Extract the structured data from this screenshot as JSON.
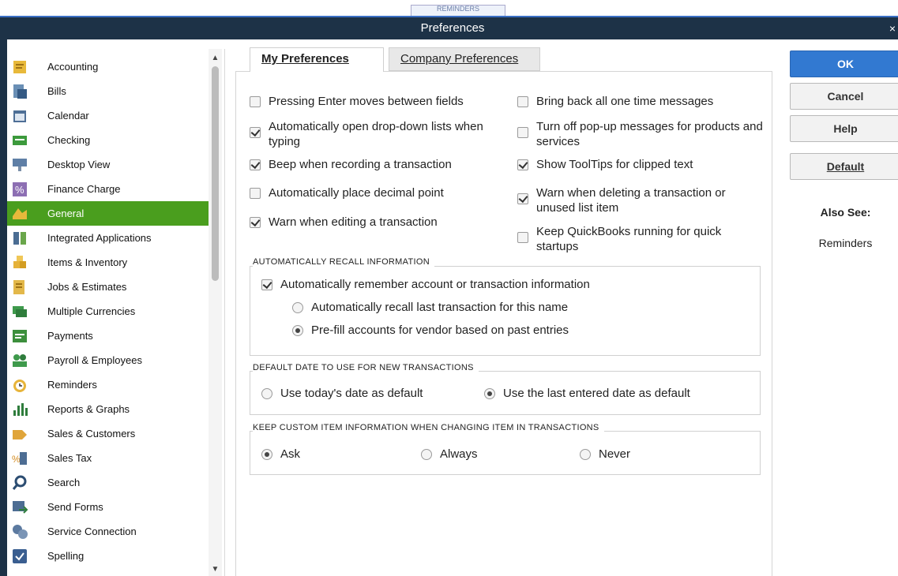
{
  "window": {
    "title": "Preferences",
    "close_glyph": "×",
    "background_tab": "REMINDERS"
  },
  "sidebar": {
    "items": [
      {
        "label": "Accounting",
        "icon": "accounting-icon"
      },
      {
        "label": "Bills",
        "icon": "bills-icon"
      },
      {
        "label": "Calendar",
        "icon": "calendar-icon"
      },
      {
        "label": "Checking",
        "icon": "checking-icon"
      },
      {
        "label": "Desktop View",
        "icon": "desktop-view-icon"
      },
      {
        "label": "Finance Charge",
        "icon": "finance-charge-icon"
      },
      {
        "label": "General",
        "icon": "general-icon",
        "active": true
      },
      {
        "label": "Integrated Applications",
        "icon": "integrated-applications-icon"
      },
      {
        "label": "Items & Inventory",
        "icon": "items-inventory-icon"
      },
      {
        "label": "Jobs & Estimates",
        "icon": "jobs-estimates-icon"
      },
      {
        "label": "Multiple Currencies",
        "icon": "multiple-currencies-icon"
      },
      {
        "label": "Payments",
        "icon": "payments-icon"
      },
      {
        "label": "Payroll & Employees",
        "icon": "payroll-employees-icon"
      },
      {
        "label": "Reminders",
        "icon": "reminders-icon"
      },
      {
        "label": "Reports & Graphs",
        "icon": "reports-graphs-icon"
      },
      {
        "label": "Sales & Customers",
        "icon": "sales-customers-icon"
      },
      {
        "label": "Sales Tax",
        "icon": "sales-tax-icon"
      },
      {
        "label": "Search",
        "icon": "search-icon"
      },
      {
        "label": "Send Forms",
        "icon": "send-forms-icon"
      },
      {
        "label": "Service Connection",
        "icon": "service-connection-icon"
      },
      {
        "label": "Spelling",
        "icon": "spelling-icon"
      }
    ]
  },
  "tabs": {
    "my": "My Preferences",
    "company": "Company Preferences"
  },
  "options": {
    "enter_moves": {
      "label": "Pressing Enter moves between fields",
      "checked": false
    },
    "auto_dropdown": {
      "label": "Automatically open drop-down lists when typing",
      "checked": true
    },
    "beep": {
      "label": "Beep when recording a transaction",
      "checked": true
    },
    "decimal": {
      "label": "Automatically place decimal point",
      "checked": false
    },
    "warn_edit": {
      "label": "Warn when editing a transaction",
      "checked": true
    },
    "bring_back": {
      "label": "Bring back all one time messages",
      "checked": false
    },
    "popups": {
      "label": "Turn off pop-up messages for products and services",
      "checked": false
    },
    "tooltips": {
      "label": "Show ToolTips for clipped text",
      "checked": true
    },
    "warn_delete": {
      "label": "Warn when deleting a transaction or unused list item",
      "checked": true
    },
    "keep_running": {
      "label": "Keep QuickBooks running for quick startups",
      "checked": false
    }
  },
  "recall": {
    "title": "AUTOMATICALLY RECALL INFORMATION",
    "remember": {
      "label": "Automatically remember account or transaction information",
      "checked": true
    },
    "last_txn": {
      "label": "Automatically recall last transaction for this name",
      "selected": false
    },
    "prefill": {
      "label": "Pre-fill accounts for vendor based on past entries",
      "selected": true
    }
  },
  "date_group": {
    "title": "DEFAULT DATE TO USE FOR NEW TRANSACTIONS",
    "today": {
      "label": "Use today's date as default",
      "selected": false
    },
    "last": {
      "label": "Use the last entered date as default",
      "selected": true
    }
  },
  "custom_group": {
    "title": "KEEP CUSTOM ITEM INFORMATION WHEN CHANGING ITEM IN TRANSACTIONS",
    "ask": {
      "label": "Ask",
      "selected": true
    },
    "always": {
      "label": "Always",
      "selected": false
    },
    "never": {
      "label": "Never",
      "selected": false
    }
  },
  "buttons": {
    "ok": "OK",
    "cancel": "Cancel",
    "help": "Help",
    "default": "Default"
  },
  "also_see": {
    "title": "Also See:",
    "link": "Reminders"
  },
  "colors": {
    "titlebar": "#1d3247",
    "active_item": "#4a9e1e",
    "ok_button": "#3279d1"
  }
}
